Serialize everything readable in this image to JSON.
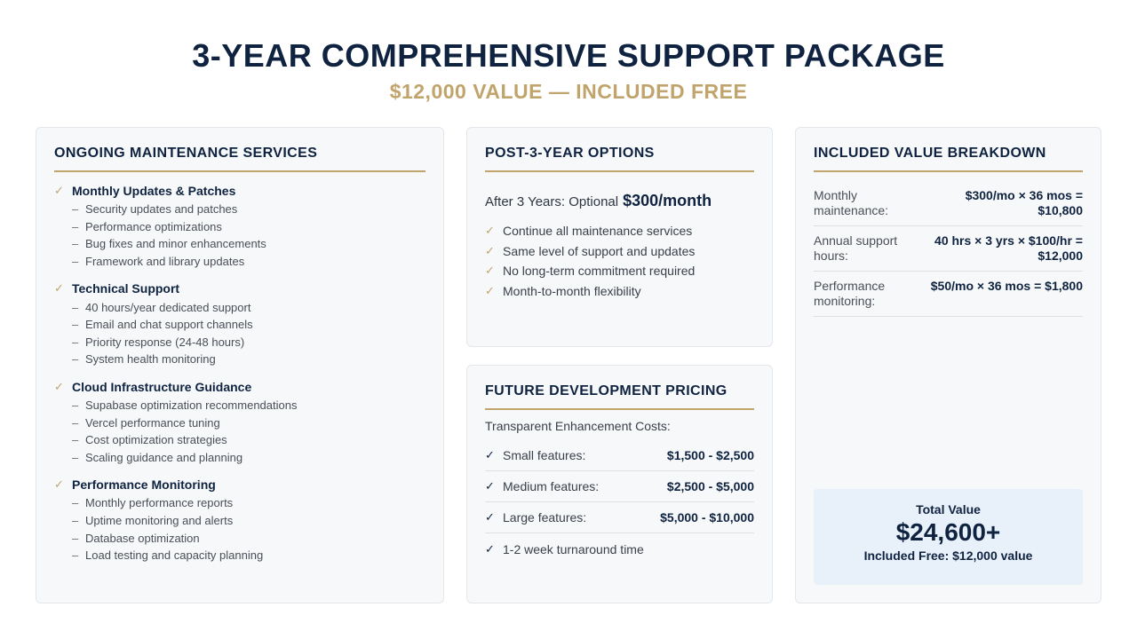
{
  "header": {
    "title": "3-YEAR COMPREHENSIVE SUPPORT PACKAGE",
    "subtitle": "$12,000 VALUE — INCLUDED FREE"
  },
  "maintenance": {
    "heading": "ONGOING MAINTENANCE SERVICES",
    "groups": [
      {
        "title": "Monthly Updates & Patches",
        "items": [
          "Security updates and patches",
          "Performance optimizations",
          "Bug fixes and minor enhancements",
          "Framework and library updates"
        ]
      },
      {
        "title": "Technical Support",
        "items": [
          "40 hours/year dedicated support",
          "Email and chat support channels",
          "Priority response (24-48 hours)",
          "System health monitoring"
        ]
      },
      {
        "title": "Cloud Infrastructure Guidance",
        "items": [
          "Supabase optimization recommendations",
          "Vercel performance tuning",
          "Cost optimization strategies",
          "Scaling guidance and planning"
        ]
      },
      {
        "title": "Performance Monitoring",
        "items": [
          "Monthly performance reports",
          "Uptime monitoring and alerts",
          "Database optimization",
          "Load testing and capacity planning"
        ]
      }
    ]
  },
  "post": {
    "heading": "POST-3-YEAR OPTIONS",
    "price_prefix": "After 3 Years: Optional",
    "price": "$300/month",
    "items": [
      "Continue all maintenance services",
      "Same level of support and updates",
      "No long-term commitment required",
      "Month-to-month flexibility"
    ]
  },
  "future": {
    "heading": "FUTURE DEVELOPMENT PRICING",
    "intro": "Transparent Enhancement Costs:",
    "rows": [
      {
        "label": "Small features:",
        "amount": "$1,500 - $2,500"
      },
      {
        "label": "Medium features:",
        "amount": "$2,500 - $5,000"
      },
      {
        "label": "Large features:",
        "amount": "$5,000 - $10,000"
      }
    ],
    "note": "1-2 week turnaround time"
  },
  "value": {
    "heading": "INCLUDED VALUE BREAKDOWN",
    "rows": [
      {
        "label": "Monthly maintenance:",
        "calc": "$300/mo × 36 mos = $10,800"
      },
      {
        "label": "Annual support hours:",
        "calc": "40 hrs × 3 yrs × $100/hr = $12,000"
      },
      {
        "label": "Performance monitoring:",
        "calc": "$50/mo × 36 mos = $1,800"
      }
    ],
    "total_label": "Total Value",
    "total_value": "$24,600+",
    "total_note": "Included Free: $12,000 value"
  },
  "icons": {
    "check": "checkmark-icon",
    "dash": "dash-bullet"
  },
  "colors": {
    "navy": "#0f2340",
    "gold": "#c1a46c",
    "total_bg": "#e8f0fa"
  }
}
